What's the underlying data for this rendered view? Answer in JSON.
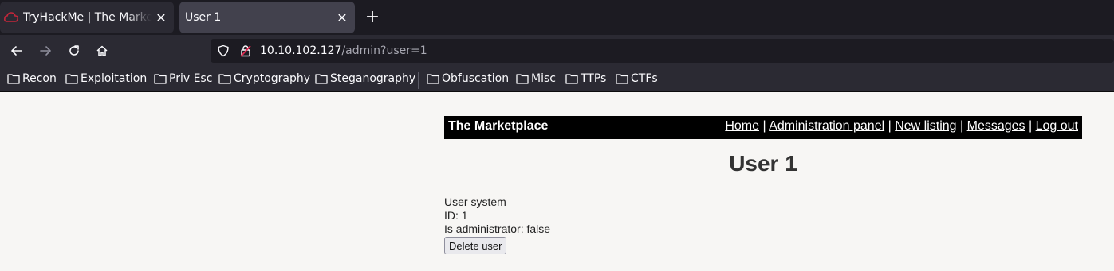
{
  "browser": {
    "tabs": [
      {
        "title": "TryHackMe | The Marketplace",
        "active": false
      },
      {
        "title": "User 1",
        "active": true
      }
    ],
    "url": {
      "host": "10.10.102.127",
      "path": "/admin?user=1"
    },
    "bookmarks": [
      "Recon",
      "Exploitation",
      "Priv Esc",
      "Cryptography",
      "Steganography",
      "Obfuscation",
      "Misc",
      "TTPs",
      "CTFs"
    ],
    "icons": {
      "back": "arrow-left-icon",
      "forward": "arrow-right-icon",
      "reload": "reload-icon",
      "home": "home-icon",
      "shield": "shield-icon",
      "insecure": "insecure-lock-icon",
      "folder": "folder-icon",
      "close": "close-icon",
      "new_tab": "plus-icon"
    }
  },
  "site": {
    "brand": "The Marketplace",
    "nav": [
      "Home",
      "Administration panel",
      "New listing",
      "Messages",
      "Log out"
    ],
    "nav_separator": "|",
    "heading": "User 1",
    "user_info": {
      "username": "User system",
      "id": "ID: 1",
      "is_admin": "Is administrator: false"
    },
    "delete_button": "Delete user"
  },
  "colors": {
    "tab_strip_bg": "#1c1b22",
    "toolbar_bg": "#2b2a33",
    "active_tab_bg": "#42414d",
    "page_bg": "#f7f6f4",
    "header_bg": "#000000",
    "insecure_red": "#e22850"
  }
}
